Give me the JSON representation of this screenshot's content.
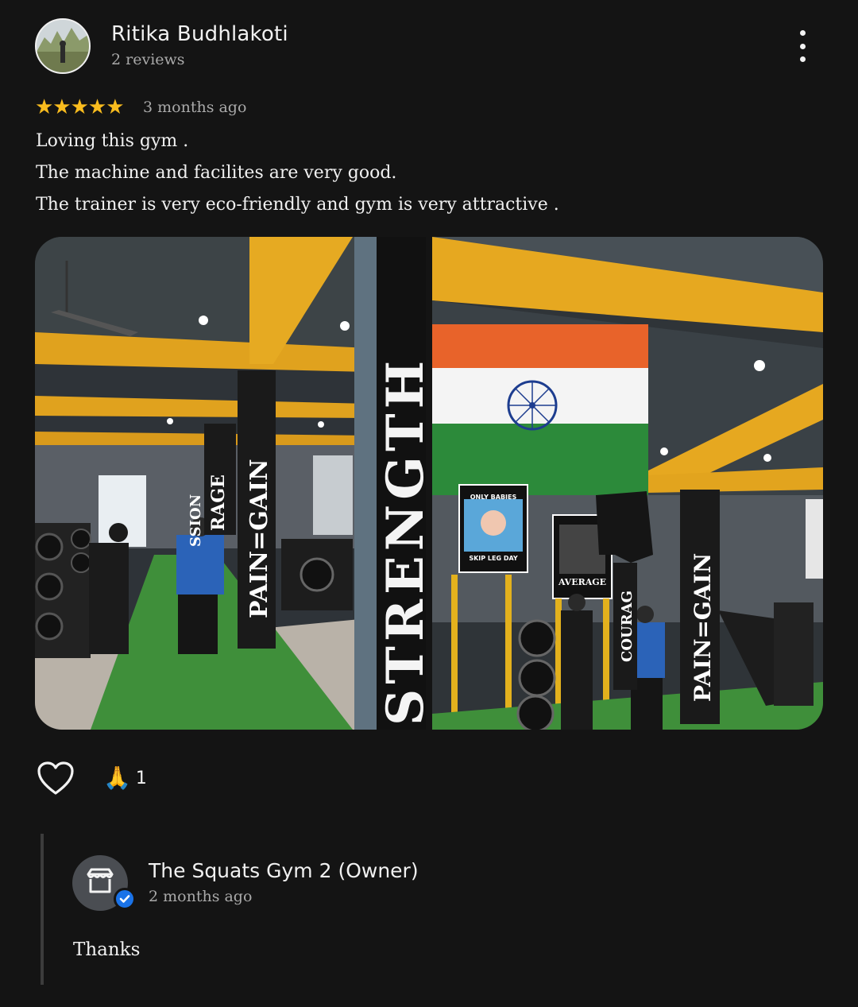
{
  "review": {
    "author": "Ritika Budhlakoti",
    "author_meta": "2 reviews",
    "rating": 5,
    "stars": "★★★★★",
    "date": "3 months ago",
    "lines": [
      "Loving this gym .",
      "The machine and facilites are very good.",
      "The trainer is very eco-friendly and gym is very attractive ."
    ]
  },
  "photos": {
    "photo1": {
      "pillar_text": "PAIN=GAIN",
      "sign_text": "RAGE",
      "sign2_text": "SSION",
      "big_pillar_text": "STRENGTH"
    },
    "photo2": {
      "poster1_top": "ONLY BABIES",
      "poster1_bottom": "SKIP LEG DAY",
      "poster2": "AVERAGE",
      "pillar_text": "PAIN=GAIN",
      "sign_text": "COURAG"
    }
  },
  "reactions": {
    "like_icon": "heart-outline-icon",
    "emoji_icon": "folded-hands-icon",
    "emoji": "🙏",
    "count": "1"
  },
  "owner_reply": {
    "name": "The Squats Gym 2 (Owner)",
    "date": "2 months ago",
    "text": "Thanks",
    "avatar_icon": "storefront-icon",
    "badge_icon": "verified-check-icon"
  },
  "colors": {
    "star": "#f9bc1e",
    "background": "#141414",
    "verified": "#1a73e8"
  }
}
